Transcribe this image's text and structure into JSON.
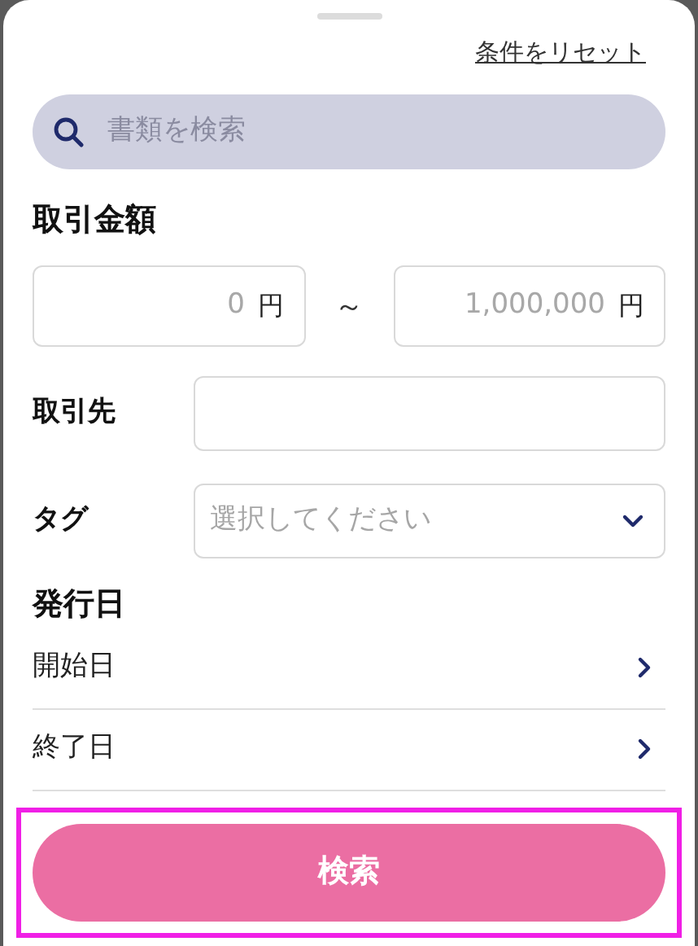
{
  "reset_link": "条件をリセット",
  "search": {
    "placeholder": "書類を検索"
  },
  "amount": {
    "heading": "取引金額",
    "min": {
      "placeholder": "0",
      "unit": "円"
    },
    "separator": "～",
    "max": {
      "placeholder": "1,000,000",
      "unit": "円"
    }
  },
  "partner": {
    "label": "取引先"
  },
  "tag": {
    "label": "タグ",
    "placeholder": "選択してください"
  },
  "issue_date": {
    "heading": "発行日",
    "rows": [
      {
        "label": "開始日"
      },
      {
        "label": "終了日"
      }
    ]
  },
  "search_button": {
    "label": "検索",
    "highlighted": true
  }
}
